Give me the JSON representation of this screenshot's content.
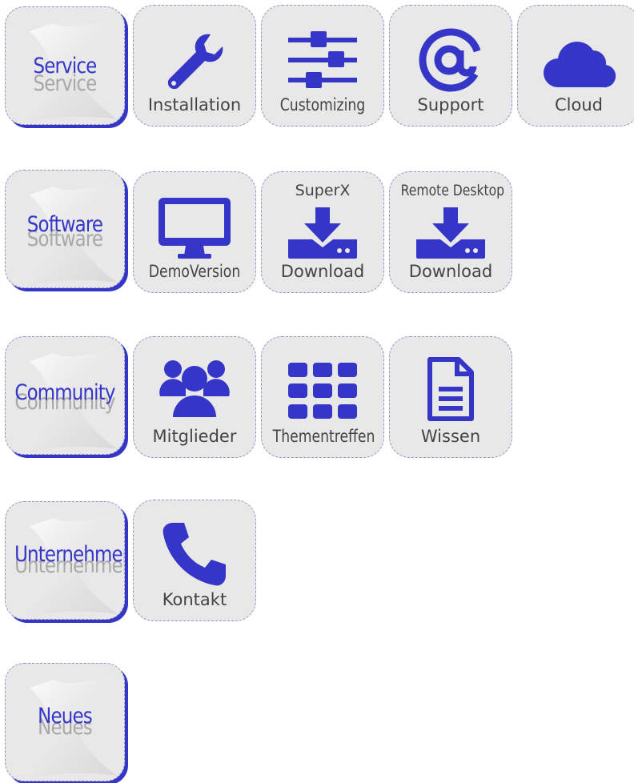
{
  "colors": {
    "accent": "#3535c8",
    "tile_bg": "#e8e8e8",
    "caption": "#444444"
  },
  "rows": [
    {
      "category": "Service",
      "tiles": [
        {
          "label": "Installation",
          "icon": "wrench-icon"
        },
        {
          "label": "Customizing",
          "icon": "sliders-icon"
        },
        {
          "label": "Support",
          "icon": "at-sign-icon"
        },
        {
          "label": "Cloud",
          "icon": "cloud-icon"
        }
      ]
    },
    {
      "category": "Software",
      "tiles": [
        {
          "label": "DemoVersion",
          "icon": "monitor-icon"
        },
        {
          "top_label": "SuperX",
          "label": "Download",
          "icon": "download-icon"
        },
        {
          "top_label": "Remote Desktop",
          "label": "Download",
          "icon": "download-icon"
        }
      ]
    },
    {
      "category": "Community",
      "tiles": [
        {
          "label": "Mitglieder",
          "icon": "users-icon"
        },
        {
          "label": "Thementreffen",
          "icon": "grid-icon"
        },
        {
          "label": "Wissen",
          "icon": "document-icon"
        }
      ]
    },
    {
      "category": "Unternehmen",
      "tiles": [
        {
          "label": "Kontakt",
          "icon": "phone-icon"
        }
      ]
    },
    {
      "category": "Neues",
      "tiles": []
    }
  ]
}
